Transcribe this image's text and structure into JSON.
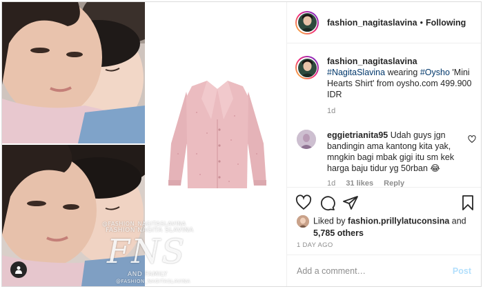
{
  "header": {
    "username": "fashion_nagitaslavina",
    "separator": "•",
    "follow_label": "Following"
  },
  "caption": {
    "username": "fashion_nagitaslavina",
    "mention_hashtag": "#NagitaSlavina",
    "word_wearing": " wearing ",
    "brand_hashtag": "#Oysho",
    "rest": " 'Mini Hearts Shirt' from oysho.com 499.900 IDR",
    "time": "1d"
  },
  "comment": {
    "username": "eggietrianita95",
    "text": " Udah guys jgn bandingin ama kantong kita yak, mngkin bagi mbak gigi itu sm kek harga baju tidur yg 50rban 😂",
    "time": "1d",
    "likes": "31 likes",
    "reply_label": "Reply"
  },
  "likes": {
    "prefix": "Liked by ",
    "liker": "fashion.prillylatuconsina",
    "and": " and",
    "count": "5,785 others"
  },
  "age": "1 DAY AGO",
  "add_comment": {
    "placeholder": "Add a comment…",
    "post_label": "Post"
  },
  "watermark": {
    "handle": "@FASHION_NAGITASLAVINA",
    "brand": "FASHION NAGITA SLAVINA",
    "logo": "FNS",
    "sub": "AND FAMILY",
    "handle_small": "@FASHION_NAGITASLAVINA"
  },
  "icons": {
    "heart": "heart-icon",
    "comment": "comment-icon",
    "share": "paper-plane-icon",
    "save": "bookmark-icon",
    "user_tag": "user-tag-icon"
  },
  "colors": {
    "link": "#00376b",
    "muted": "#8e8e8e",
    "post_disabled": "#b2dffc",
    "shirt": "#e9b9bd"
  }
}
